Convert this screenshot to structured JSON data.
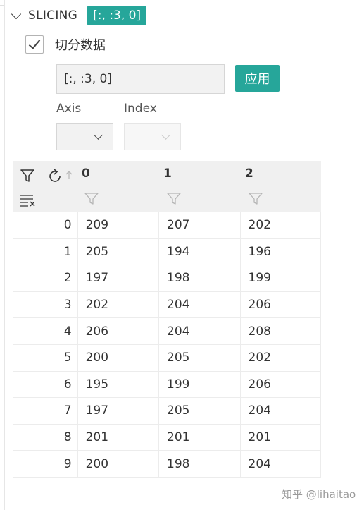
{
  "section": {
    "title": "SLICING",
    "badge": "[:, :3, 0]"
  },
  "checkbox": {
    "label": "切分数据",
    "checked": true
  },
  "slice_input": {
    "value": "[:, :3, 0]"
  },
  "apply_button": {
    "label": "应用"
  },
  "axis": {
    "label": "Axis",
    "value": ""
  },
  "index": {
    "label": "Index",
    "value": ""
  },
  "table": {
    "columns": [
      "0",
      "1",
      "2"
    ],
    "rows": [
      {
        "index": "0",
        "values": [
          "209",
          "207",
          "202"
        ]
      },
      {
        "index": "1",
        "values": [
          "205",
          "194",
          "196"
        ]
      },
      {
        "index": "2",
        "values": [
          "197",
          "198",
          "199"
        ]
      },
      {
        "index": "3",
        "values": [
          "202",
          "204",
          "206"
        ]
      },
      {
        "index": "4",
        "values": [
          "206",
          "204",
          "208"
        ]
      },
      {
        "index": "5",
        "values": [
          "200",
          "205",
          "202"
        ]
      },
      {
        "index": "6",
        "values": [
          "195",
          "199",
          "206"
        ]
      },
      {
        "index": "7",
        "values": [
          "197",
          "205",
          "204"
        ]
      },
      {
        "index": "8",
        "values": [
          "201",
          "201",
          "201"
        ]
      },
      {
        "index": "9",
        "values": [
          "200",
          "198",
          "204"
        ]
      }
    ]
  },
  "watermark": "知乎 @lihaitao",
  "colors": {
    "accent": "#26a69a"
  }
}
